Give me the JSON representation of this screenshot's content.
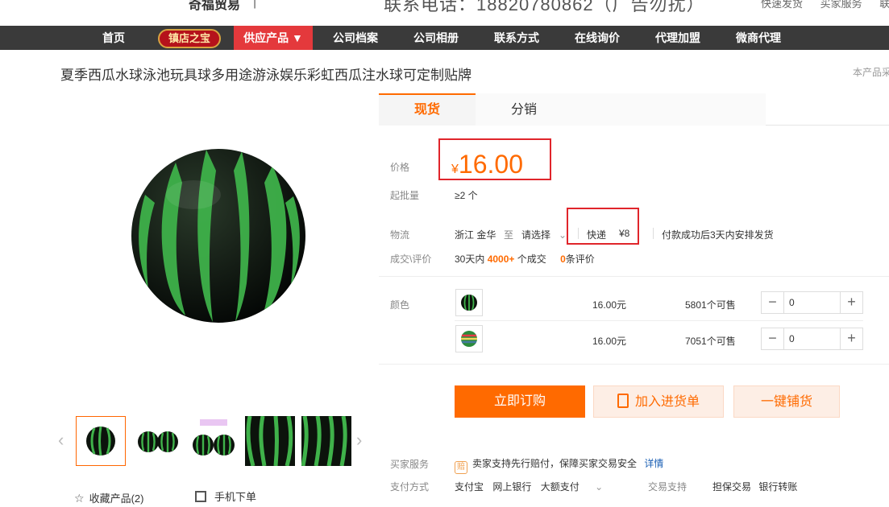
{
  "header": {
    "brand": "奇福贸易",
    "brand_sep": "|",
    "hotline": "联系电话：18820780862（广告勿扰）",
    "top_links": [
      "快速发货",
      "买家服务",
      "联系我们"
    ]
  },
  "nav": {
    "items": [
      "首页",
      "镇店之宝",
      "供应产品 ▼",
      "公司档案",
      "公司相册",
      "联系方式",
      "在线询价",
      "代理加盟",
      "微商代理"
    ],
    "active_index": 2
  },
  "product": {
    "title": "夏季西瓜水球泳池玩具球多用途游泳娱乐彩虹西瓜注水球可定制贴牌",
    "title_right": "本产品采"
  },
  "gallery": {
    "thumb_count": 5,
    "prev_arrow": "‹",
    "next_arrow": "›",
    "favorite_label": "收藏产品(2)",
    "mobile_label": "手机下单"
  },
  "tabs": [
    {
      "label": "现货",
      "active": true
    },
    {
      "label": "分销",
      "active": false
    }
  ],
  "pricing": {
    "price_label": "价格",
    "currency": "¥",
    "price": "16.00",
    "min_order_label": "起批量",
    "min_order": "≥2 个"
  },
  "logistics": {
    "label": "物流",
    "origin": "浙江 金华",
    "to": "至",
    "destination": "请选择",
    "carrier": "快递",
    "fee": "¥8",
    "ship_note": "付款成功后3天内安排发货"
  },
  "deals": {
    "label": "成交\\评价",
    "period": "30天内",
    "count": "4000+",
    "count_unit": "个成交",
    "reviews": "0",
    "reviews_unit": "条评价"
  },
  "variants": {
    "label": "颜色",
    "rows": [
      {
        "price": "16.00元",
        "stock": "5801个可售",
        "qty": "0"
      },
      {
        "price": "16.00元",
        "stock": "7051个可售",
        "qty": "0"
      }
    ]
  },
  "actions": {
    "buy": "立即订购",
    "cart": "加入进货单",
    "one_click": "一键铺货"
  },
  "service": {
    "label": "买家服务",
    "badge": "赔",
    "text": "卖家支持先行赔付，保障买家交易安全",
    "detail_link": "详情"
  },
  "payment": {
    "label": "支付方式",
    "methods": [
      "支付宝",
      "网上银行",
      "大额支付"
    ],
    "trade_label": "交易支持",
    "trade_items": [
      "担保交易",
      "银行转账"
    ]
  },
  "colors": {
    "accent": "#ff6a00",
    "nav_bg": "#3a3a3a",
    "nav_active": "#e4393c",
    "highlight_box": "#e0252b"
  }
}
